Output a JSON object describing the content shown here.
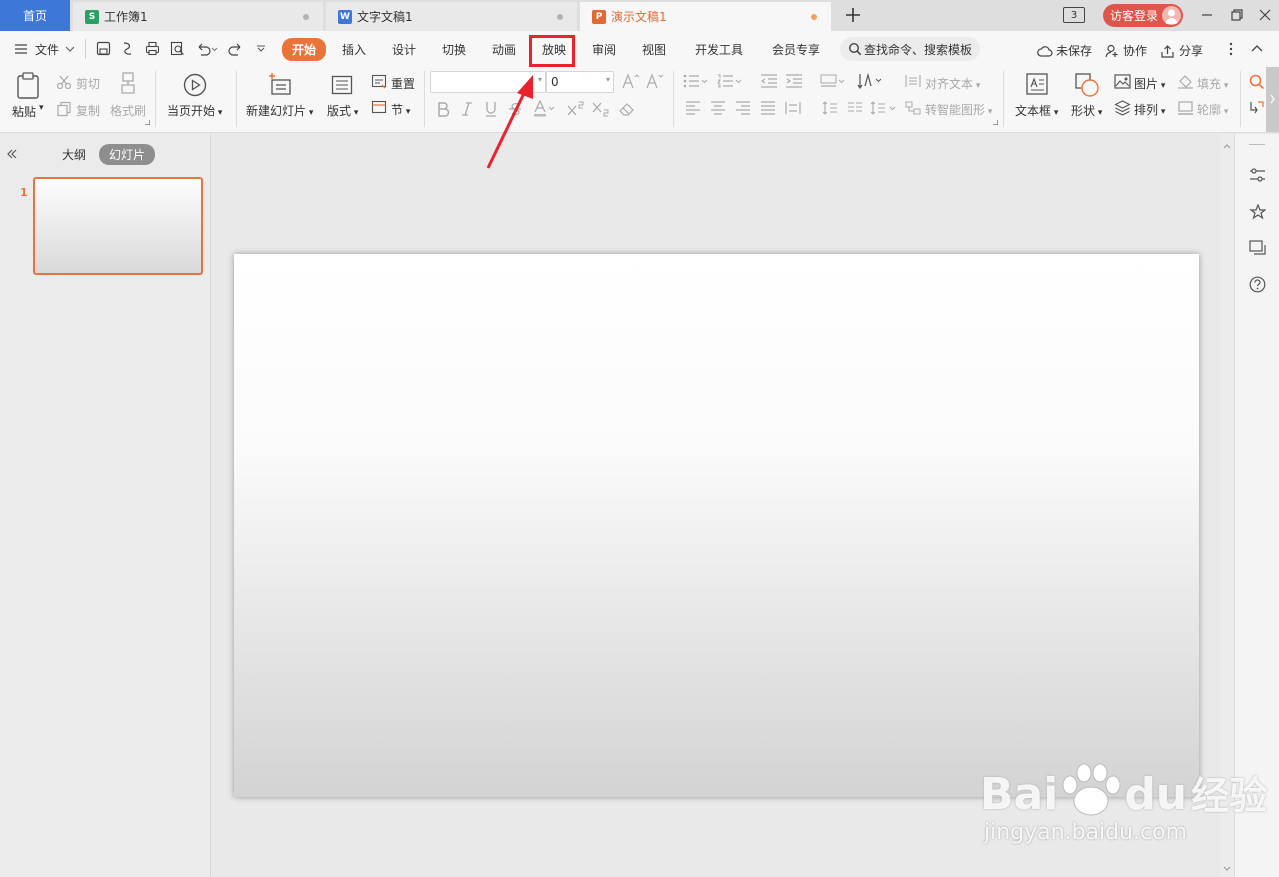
{
  "tabs": {
    "home": "首页",
    "docs": [
      {
        "label": "工作簿1",
        "icon": "S",
        "color": "#28a062"
      },
      {
        "label": "文字文稿1",
        "icon": "W",
        "color": "#3d78d8"
      },
      {
        "label": "演示文稿1",
        "icon": "P",
        "color": "#e06a33"
      }
    ],
    "new_tab": "+"
  },
  "window": {
    "screen_count": "3",
    "login": "访客登录"
  },
  "menu": {
    "file": "文件",
    "items": [
      "开始",
      "插入",
      "设计",
      "切换",
      "动画",
      "放映",
      "审阅",
      "视图",
      "开发工具",
      "会员专享"
    ],
    "search_placeholder": "查找命令、搜索模板",
    "right": {
      "unsaved": "未保存",
      "collab": "协作",
      "share": "分享"
    }
  },
  "ribbon": {
    "paste": "粘贴",
    "cut": "剪切",
    "copy": "复制",
    "format_painter": "格式刷",
    "from_current": "当页开始",
    "new_slide": "新建幻灯片",
    "layout": "版式",
    "reset": "重置",
    "section": "节",
    "font_size": "0",
    "align_text": "对齐文本",
    "smartart": "转智能图形",
    "textbox": "文本框",
    "shape": "形状",
    "picture": "图片",
    "arrange": "排列",
    "fill": "填充",
    "outline": "轮廓"
  },
  "panel": {
    "outline_tab": "大纲",
    "slides_tab": "幻灯片",
    "slide_number": "1"
  },
  "watermark": {
    "brand": "Bai",
    "brand2": "du",
    "cn": "经验",
    "url": "jingyan.baidu.com"
  },
  "colors": {
    "accent": "#e9743a",
    "highlight": "#e8232d",
    "home_tab": "#3d78d8",
    "login": "#e0554b"
  },
  "icons": [
    "menu-icon",
    "save-icon",
    "print-icon",
    "undo-icon",
    "redo-icon",
    "search-icon",
    "cloud-icon",
    "user-icon",
    "share-icon",
    "paste-icon",
    "scissors-icon",
    "play-icon",
    "new-slide-icon",
    "textbox-icon",
    "shape-icon",
    "picture-icon"
  ]
}
